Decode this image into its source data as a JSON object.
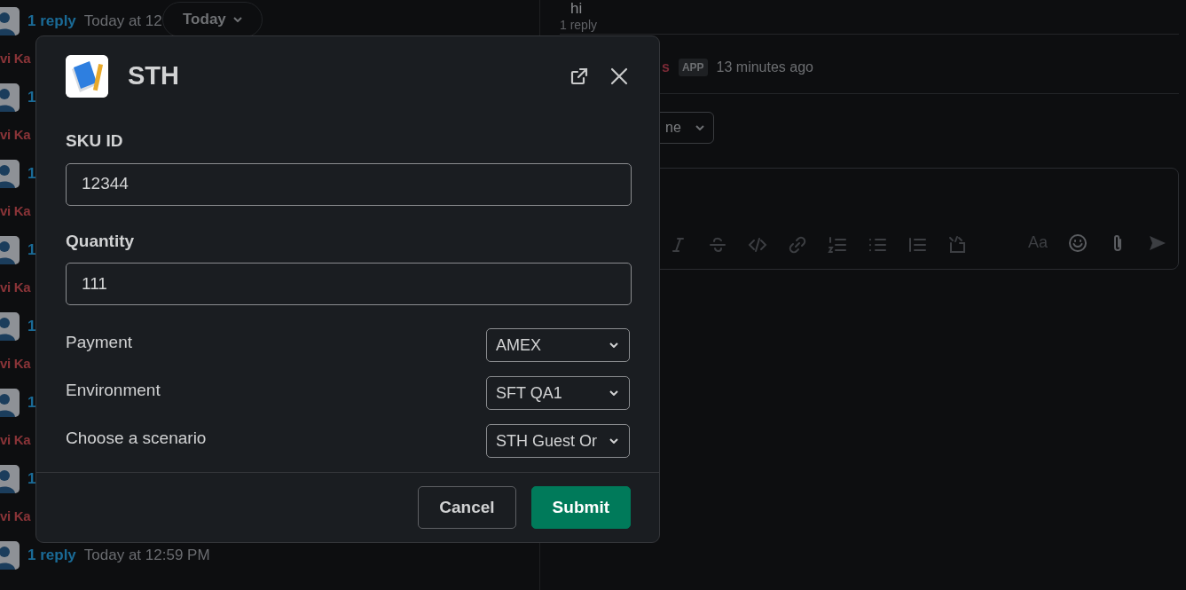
{
  "background": {
    "date_pill": "Today",
    "left_rows": [
      {
        "kind": "reply",
        "reply": "1 reply",
        "time": "Today at 12"
      },
      {
        "kind": "name",
        "name": "vi Ka"
      },
      {
        "kind": "reply",
        "reply": "1"
      },
      {
        "kind": "name",
        "name": "vi Ka"
      },
      {
        "kind": "reply",
        "reply": "1"
      },
      {
        "kind": "name",
        "name": "vi Ka"
      },
      {
        "kind": "reply",
        "reply": "1"
      },
      {
        "kind": "name",
        "name": "vi Ka"
      },
      {
        "kind": "reply",
        "reply": "1"
      },
      {
        "kind": "name",
        "name": "vi Ka"
      },
      {
        "kind": "reply",
        "reply": "1"
      },
      {
        "kind": "name",
        "name": "vi Ka"
      },
      {
        "kind": "reply",
        "reply": "1"
      },
      {
        "kind": "name",
        "name": "vi Ka"
      },
      {
        "kind": "reply",
        "reply": "1 reply",
        "time": "Today at 12:59 PM"
      }
    ],
    "thread": {
      "message": "hi",
      "reply_count": "1 reply",
      "sender": "s",
      "badge": "APP",
      "time": "13 minutes ago",
      "select_value": "ne",
      "format_toggle": "Aa"
    }
  },
  "dialog": {
    "title": "STH",
    "fields": [
      {
        "kind": "text",
        "label": "SKU ID",
        "value": "12344"
      },
      {
        "kind": "text",
        "label": "Quantity",
        "value": "111"
      },
      {
        "kind": "select",
        "label": "Payment",
        "value": "AMEX"
      },
      {
        "kind": "select",
        "label": "Environment",
        "value": "SFT QA1"
      },
      {
        "kind": "select",
        "label": "Choose a scenario",
        "value": "STH Guest Or"
      }
    ],
    "buttons": [
      {
        "kind": "secondary",
        "label": "Cancel"
      },
      {
        "kind": "primary",
        "label": "Submit"
      }
    ]
  }
}
